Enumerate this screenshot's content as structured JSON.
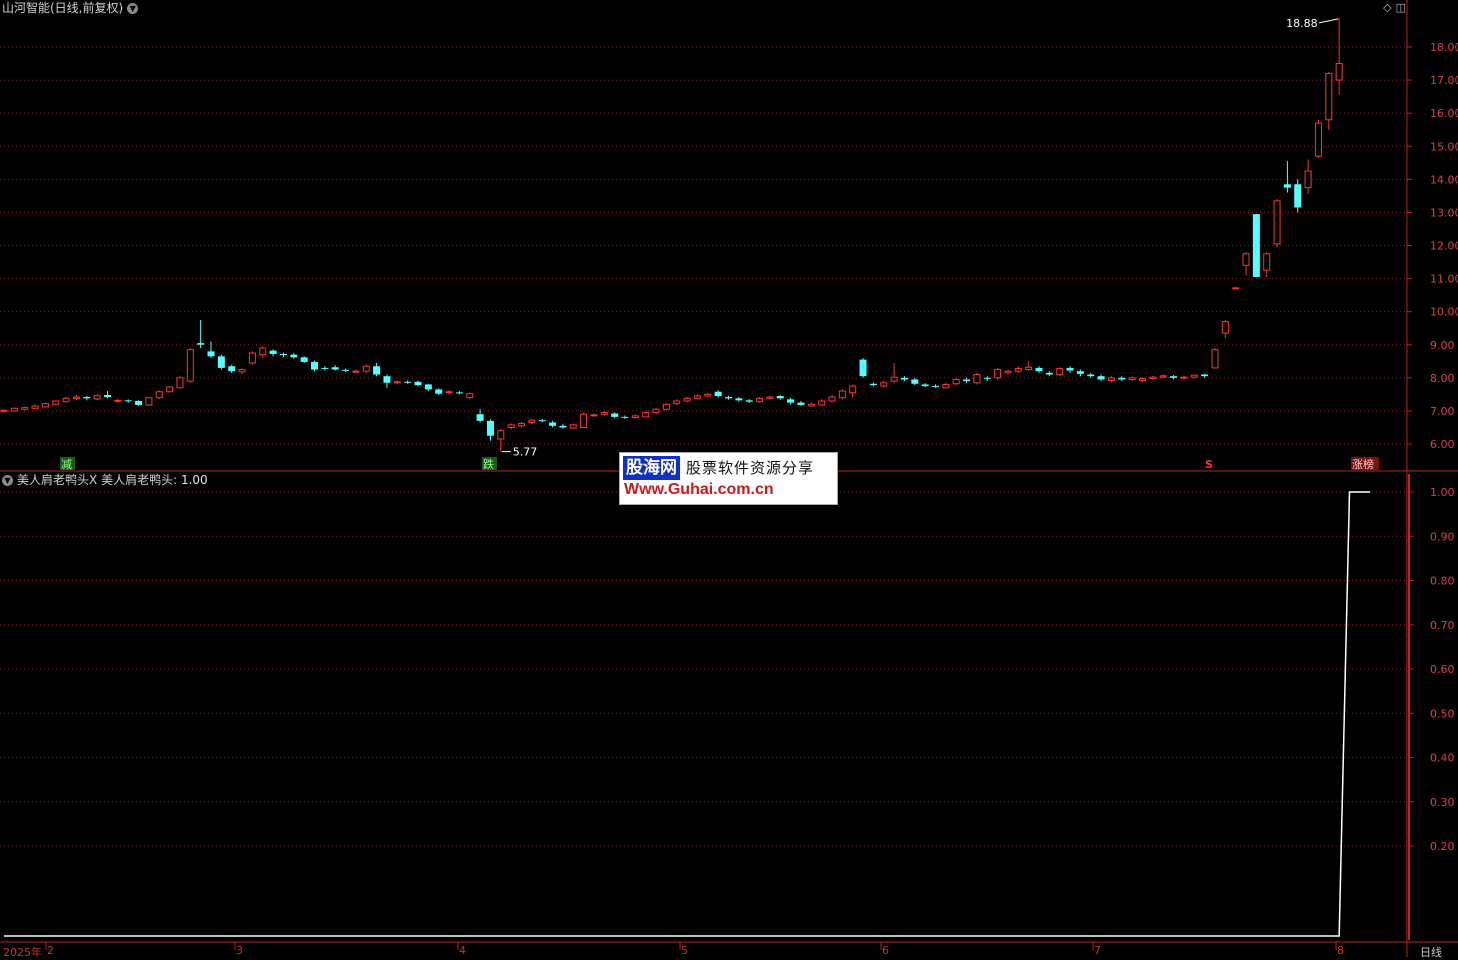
{
  "header": {
    "title": "山河智能(日线,前复权)",
    "dropdown_icon": "chevron-down-icon"
  },
  "indicator": {
    "title": "美人肩老鸭头X",
    "series_label": "美人肩老鸭头:",
    "value": "1.00"
  },
  "markers": {
    "peak_label": "18.88",
    "low_label": "5.77",
    "signal_jian": "减",
    "signal_die": "跌",
    "signal_s": "S",
    "signal_zhangting": "涨榜"
  },
  "price_axis": [
    "18.00",
    "17.00",
    "16.00",
    "15.00",
    "14.00",
    "13.00",
    "12.00",
    "11.00",
    "10.00",
    "9.00",
    "8.00",
    "7.00",
    "6.00"
  ],
  "indicator_axis": [
    "1.00",
    "0.90",
    "0.80",
    "0.70",
    "0.60",
    "0.50",
    "0.40",
    "0.30",
    "0.20"
  ],
  "date_axis": {
    "labels": [
      "2025年",
      "2",
      "3",
      "4",
      "5",
      "6",
      "7",
      "8"
    ],
    "period": "日线"
  },
  "watermark": {
    "logo": "股海网",
    "slogan": "股票软件资源分享",
    "url": "Www.Guhai.com.cn"
  },
  "colors": {
    "up": "#ff3232",
    "down": "#54ffff",
    "grid": "#8b1a1a",
    "axis": "#c81e1e",
    "indicator_line": "#ffffff"
  },
  "chart_data": [
    {
      "type": "candlestick",
      "title": "山河智能(日线,前复权)",
      "ylim": [
        5.5,
        18.9
      ],
      "y_ticks": [
        6,
        7,
        8,
        9,
        10,
        11,
        12,
        13,
        14,
        15,
        16,
        17,
        18
      ],
      "highlights": {
        "max": 18.88,
        "min": 5.77
      },
      "candles": [
        [
          7.0,
          7.02,
          7.05,
          6.95
        ],
        [
          7.0,
          7.08,
          7.1,
          6.98
        ],
        [
          7.05,
          7.1,
          7.13,
          7.02
        ],
        [
          7.08,
          7.15,
          7.2,
          7.05
        ],
        [
          7.12,
          7.22,
          7.25,
          7.1
        ],
        [
          7.2,
          7.3,
          7.32,
          7.18
        ],
        [
          7.28,
          7.38,
          7.42,
          7.25
        ],
        [
          7.38,
          7.42,
          7.48,
          7.34
        ],
        [
          7.42,
          7.38,
          7.45,
          7.32
        ],
        [
          7.36,
          7.46,
          7.5,
          7.33
        ],
        [
          7.48,
          7.42,
          7.6,
          7.38
        ],
        [
          7.3,
          7.32,
          7.36,
          7.26
        ],
        [
          7.32,
          7.3,
          7.35,
          7.25
        ],
        [
          7.3,
          7.18,
          7.32,
          7.15
        ],
        [
          7.18,
          7.4,
          7.42,
          7.15
        ],
        [
          7.4,
          7.58,
          7.62,
          7.36
        ],
        [
          7.58,
          7.72,
          7.75,
          7.55
        ],
        [
          7.7,
          8.0,
          8.05,
          7.68
        ],
        [
          7.9,
          8.85,
          8.9,
          7.85
        ],
        [
          9.05,
          9.0,
          9.75,
          8.9
        ],
        [
          8.8,
          8.65,
          9.1,
          8.6
        ],
        [
          8.65,
          8.3,
          8.7,
          8.25
        ],
        [
          8.35,
          8.2,
          8.4,
          8.15
        ],
        [
          8.18,
          8.25,
          8.28,
          8.12
        ],
        [
          8.45,
          8.75,
          8.8,
          8.4
        ],
        [
          8.7,
          8.9,
          8.95,
          8.6
        ],
        [
          8.82,
          8.72,
          8.86,
          8.65
        ],
        [
          8.72,
          8.7,
          8.76,
          8.62
        ],
        [
          8.7,
          8.62,
          8.75,
          8.58
        ],
        [
          8.62,
          8.48,
          8.65,
          8.45
        ],
        [
          8.48,
          8.25,
          8.52,
          8.2
        ],
        [
          8.3,
          8.28,
          8.35,
          8.22
        ],
        [
          8.32,
          8.25,
          8.38,
          8.22
        ],
        [
          8.24,
          8.22,
          8.28,
          8.18
        ],
        [
          8.2,
          8.2,
          8.25,
          8.16
        ],
        [
          8.2,
          8.35,
          8.4,
          8.15
        ],
        [
          8.35,
          8.1,
          8.45,
          8.05
        ],
        [
          8.05,
          7.85,
          8.1,
          7.7
        ],
        [
          7.85,
          7.88,
          7.92,
          7.82
        ],
        [
          7.88,
          7.86,
          7.92,
          7.82
        ],
        [
          7.88,
          7.78,
          7.92,
          7.75
        ],
        [
          7.8,
          7.65,
          7.82,
          7.6
        ],
        [
          7.65,
          7.52,
          7.68,
          7.48
        ],
        [
          7.55,
          7.58,
          7.62,
          7.5
        ],
        [
          7.56,
          7.54,
          7.6,
          7.5
        ],
        [
          7.4,
          7.52,
          7.55,
          7.36
        ],
        [
          6.9,
          6.7,
          7.05,
          6.65
        ],
        [
          6.7,
          6.25,
          6.75,
          6.1
        ],
        [
          6.15,
          6.4,
          6.45,
          5.77
        ],
        [
          6.5,
          6.58,
          6.62,
          6.45
        ],
        [
          6.55,
          6.62,
          6.66,
          6.5
        ],
        [
          6.65,
          6.72,
          6.75,
          6.6
        ],
        [
          6.72,
          6.7,
          6.76,
          6.66
        ],
        [
          6.65,
          6.55,
          6.7,
          6.5
        ],
        [
          6.55,
          6.5,
          6.6,
          6.46
        ],
        [
          6.48,
          6.58,
          6.62,
          6.45
        ],
        [
          6.5,
          6.9,
          6.95,
          6.48
        ],
        [
          6.85,
          6.88,
          6.92,
          6.82
        ],
        [
          6.9,
          6.95,
          7.0,
          6.85
        ],
        [
          6.92,
          6.82,
          6.96,
          6.78
        ],
        [
          6.82,
          6.8,
          6.86,
          6.76
        ],
        [
          6.8,
          6.85,
          6.9,
          6.78
        ],
        [
          6.82,
          6.95,
          6.98,
          6.8
        ],
        [
          6.95,
          7.05,
          7.1,
          6.92
        ],
        [
          7.05,
          7.2,
          7.25,
          7.02
        ],
        [
          7.22,
          7.3,
          7.35,
          7.18
        ],
        [
          7.3,
          7.38,
          7.42,
          7.26
        ],
        [
          7.38,
          7.45,
          7.5,
          7.35
        ],
        [
          7.45,
          7.5,
          7.55,
          7.42
        ],
        [
          7.58,
          7.45,
          7.62,
          7.4
        ],
        [
          7.42,
          7.38,
          7.46,
          7.34
        ],
        [
          7.38,
          7.32,
          7.42,
          7.28
        ],
        [
          7.32,
          7.28,
          7.36,
          7.24
        ],
        [
          7.28,
          7.38,
          7.42,
          7.25
        ],
        [
          7.38,
          7.42,
          7.46,
          7.34
        ],
        [
          7.45,
          7.38,
          7.48,
          7.34
        ],
        [
          7.35,
          7.25,
          7.4,
          7.2
        ],
        [
          7.25,
          7.18,
          7.3,
          7.15
        ],
        [
          7.15,
          7.2,
          7.25,
          7.12
        ],
        [
          7.18,
          7.3,
          7.35,
          7.15
        ],
        [
          7.3,
          7.42,
          7.48,
          7.25
        ],
        [
          7.4,
          7.6,
          7.65,
          7.35
        ],
        [
          7.55,
          7.75,
          7.8,
          7.4
        ],
        [
          8.55,
          8.05,
          8.6,
          8.0
        ],
        [
          7.82,
          7.78,
          7.86,
          7.74
        ],
        [
          7.75,
          7.85,
          7.9,
          7.7
        ],
        [
          7.9,
          8.02,
          8.45,
          7.85
        ],
        [
          8.0,
          7.95,
          8.05,
          7.9
        ],
        [
          7.95,
          7.82,
          8.0,
          7.78
        ],
        [
          7.8,
          7.75,
          7.84,
          7.72
        ],
        [
          7.75,
          7.72,
          7.8,
          7.7
        ],
        [
          7.7,
          7.8,
          7.85,
          7.68
        ],
        [
          7.82,
          7.95,
          8.0,
          7.78
        ],
        [
          7.95,
          7.9,
          8.0,
          7.85
        ],
        [
          7.85,
          8.1,
          8.15,
          7.8
        ],
        [
          8.0,
          7.98,
          8.05,
          7.9
        ],
        [
          8.0,
          8.25,
          8.3,
          7.95
        ],
        [
          8.15,
          8.2,
          8.25,
          8.1
        ],
        [
          8.2,
          8.28,
          8.35,
          8.15
        ],
        [
          8.25,
          8.32,
          8.5,
          8.2
        ],
        [
          8.3,
          8.2,
          8.35,
          8.15
        ],
        [
          8.15,
          8.1,
          8.2,
          8.05
        ],
        [
          8.1,
          8.28,
          8.32,
          8.05
        ],
        [
          8.3,
          8.22,
          8.35,
          8.15
        ],
        [
          8.2,
          8.12,
          8.25,
          8.05
        ],
        [
          8.1,
          8.05,
          8.15,
          8.0
        ],
        [
          8.05,
          7.95,
          8.1,
          7.9
        ],
        [
          7.92,
          8.0,
          8.05,
          7.88
        ],
        [
          8.0,
          7.95,
          8.05,
          7.9
        ],
        [
          7.95,
          8.0,
          8.05,
          7.9
        ],
        [
          7.92,
          7.98,
          8.02,
          7.88
        ],
        [
          7.98,
          8.02,
          8.06,
          7.95
        ],
        [
          8.02,
          8.06,
          8.1,
          7.98
        ],
        [
          8.05,
          8.0,
          8.08,
          7.95
        ],
        [
          8.0,
          8.02,
          8.06,
          7.96
        ],
        [
          8.02,
          8.08,
          8.1,
          7.98
        ],
        [
          8.1,
          8.05,
          8.12,
          8.0
        ],
        [
          8.3,
          8.85,
          8.9,
          8.28
        ],
        [
          9.35,
          9.7,
          9.75,
          9.2
        ],
        [
          10.72,
          10.72,
          10.75,
          10.7
        ],
        [
          11.4,
          11.75,
          11.8,
          11.1
        ],
        [
          12.95,
          11.05,
          12.95,
          11.05
        ],
        [
          11.25,
          11.75,
          11.8,
          11.05
        ],
        [
          12.05,
          13.35,
          13.4,
          11.95
        ],
        [
          13.85,
          13.75,
          14.55,
          13.6
        ],
        [
          13.85,
          13.15,
          14.0,
          13.0
        ],
        [
          13.75,
          14.25,
          14.6,
          13.55
        ],
        [
          14.7,
          15.7,
          15.8,
          14.65
        ],
        [
          15.8,
          17.2,
          17.25,
          15.5
        ],
        [
          17.0,
          17.5,
          18.88,
          16.55
        ]
      ]
    },
    {
      "type": "line",
      "title": "美人肩老鸭头X",
      "series": [
        {
          "name": "美人肩老鸭头",
          "values": [
            0,
            0,
            0,
            0,
            0,
            0,
            0,
            0,
            0,
            0,
            0,
            0,
            0,
            0,
            0,
            0,
            0,
            0,
            0,
            0,
            0,
            0,
            0,
            0,
            0,
            0,
            0,
            0,
            0,
            0,
            0,
            0,
            0,
            0,
            0,
            0,
            0,
            0,
            0,
            0,
            0,
            0,
            0,
            0,
            0,
            0,
            0,
            0,
            0,
            0,
            0,
            0,
            0,
            0,
            0,
            0,
            0,
            0,
            0,
            0,
            0,
            0,
            0,
            0,
            0,
            0,
            0,
            0,
            0,
            0,
            0,
            0,
            0,
            0,
            0,
            0,
            0,
            0,
            0,
            0,
            0,
            0,
            0,
            0,
            0,
            0,
            0,
            0,
            0,
            0,
            0,
            0,
            0,
            0,
            0,
            0,
            0,
            0,
            0,
            0,
            0,
            0,
            0,
            0,
            0,
            0,
            0,
            0,
            0,
            0,
            0,
            0,
            0,
            0,
            0,
            0,
            0,
            0,
            0,
            0,
            0,
            0,
            0,
            0,
            0,
            0,
            0,
            0,
            0,
            0,
            1,
            1,
            1
          ]
        }
      ],
      "ylim": [
        0.1,
        1.0
      ],
      "y_ticks": [
        0.2,
        0.3,
        0.4,
        0.5,
        0.6,
        0.7,
        0.8,
        0.9,
        1.0
      ]
    }
  ]
}
